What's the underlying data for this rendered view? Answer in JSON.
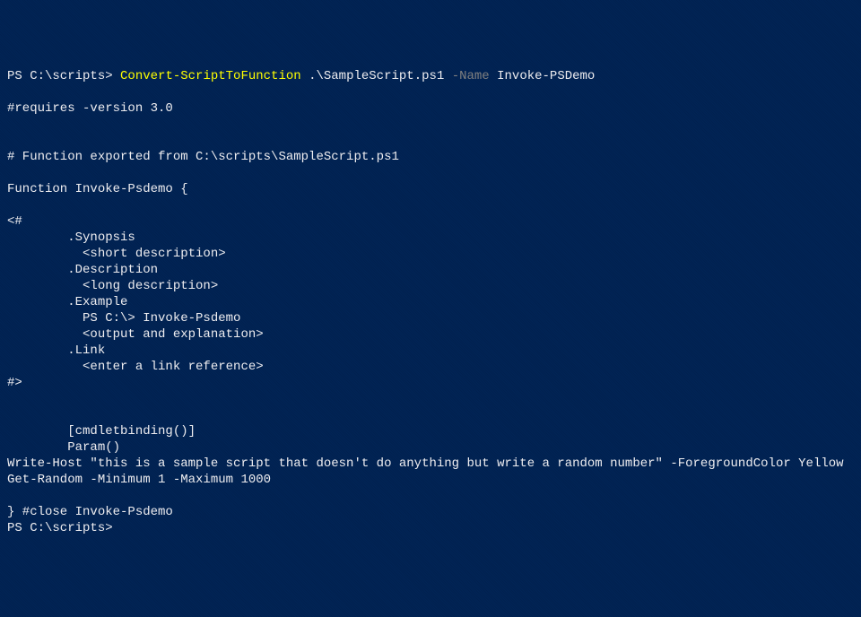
{
  "prompt1": {
    "prefix": "PS C:\\scripts> ",
    "cmdlet": "Convert-ScriptToFunction",
    "arg1": " .\\SampleScript.ps1 ",
    "param": "-Name",
    "arg2": " Invoke-PSDemo"
  },
  "output": {
    "l1": "",
    "l2": "#requires -version 3.0",
    "l3": "",
    "l4": "",
    "l5": "# Function exported from C:\\scripts\\SampleScript.ps1",
    "l6": "",
    "l7": "Function Invoke-Psdemo {",
    "l8": "",
    "l9": "<#",
    "l10": "        .Synopsis",
    "l11": "          <short description>",
    "l12": "        .Description",
    "l13": "          <long description>",
    "l14": "        .Example",
    "l15": "          PS C:\\> Invoke-Psdemo",
    "l16": "          <output and explanation>",
    "l17": "        .Link",
    "l18": "          <enter a link reference>",
    "l19": "#>",
    "l20": "",
    "l21": "",
    "l22": "        [cmdletbinding()]",
    "l23": "        Param()",
    "l24": "Write-Host \"this is a sample script that doesn't do anything but write a random number\" -ForegroundColor Yellow",
    "l25": "Get-Random -Minimum 1 -Maximum 1000",
    "l26": "",
    "l27": "} #close Invoke-Psdemo"
  },
  "prompt2": {
    "prefix": "PS C:\\scripts>"
  }
}
